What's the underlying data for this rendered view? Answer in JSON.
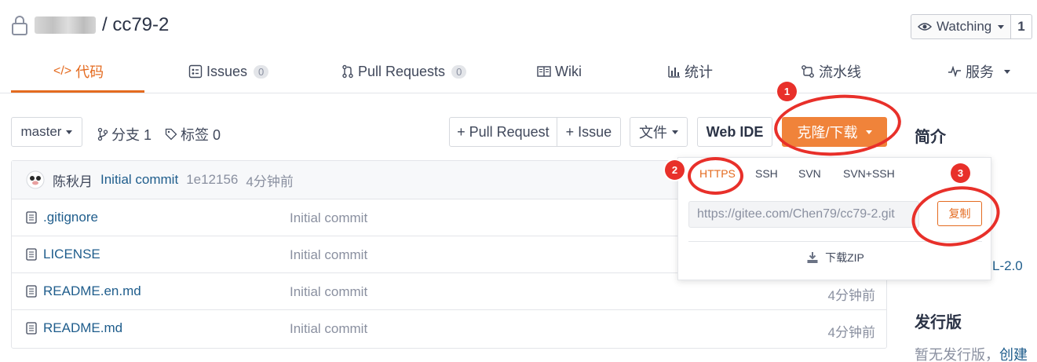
{
  "header": {
    "repo_name": "/ cc79-2",
    "watch_label": "Watching",
    "watch_count": "1"
  },
  "tabs": [
    {
      "label": "代码"
    },
    {
      "label": "Issues",
      "badge": "0"
    },
    {
      "label": "Pull Requests",
      "badge": "0"
    },
    {
      "label": "Wiki"
    },
    {
      "label": "统计"
    },
    {
      "label": "流水线"
    },
    {
      "label": "服务"
    }
  ],
  "toolbar": {
    "branch": "master",
    "branches": "分支 1",
    "tags": "标签 0",
    "pull_request": "+ Pull Request",
    "issue": "+ Issue",
    "file_menu": "文件",
    "web_ide": "Web IDE",
    "clone": "克隆/下载"
  },
  "commit": {
    "author": "陈秋月",
    "message": "Initial commit",
    "hash": "1e12156",
    "time": "4分钟前"
  },
  "files": [
    {
      "name": ".gitignore",
      "message": "Initial commit",
      "time": ""
    },
    {
      "name": "LICENSE",
      "message": "Initial commit",
      "time": ""
    },
    {
      "name": "README.en.md",
      "message": "Initial commit",
      "time": "4分钟前"
    },
    {
      "name": "README.md",
      "message": "Initial commit",
      "time": "4分钟前"
    }
  ],
  "clone_menu": {
    "protocols": [
      "HTTPS",
      "SSH",
      "SVN",
      "SVN+SSH"
    ],
    "url": "https://gitee.com/Chen79/cc79-2.git",
    "copy": "复制",
    "download_zip": "下载ZIP"
  },
  "sidebar": {
    "intro_heading": "简介",
    "license_fragment": "L-2.0",
    "releases_heading": "发行版",
    "releases_text": "暂无发行版，",
    "create_link": "创建"
  },
  "annotations": [
    "1",
    "2",
    "3"
  ],
  "colors": {
    "accent": "#e46b20",
    "clone_button": "#f0833a",
    "annotation": "#e8302a",
    "link": "#1f5d8c"
  }
}
